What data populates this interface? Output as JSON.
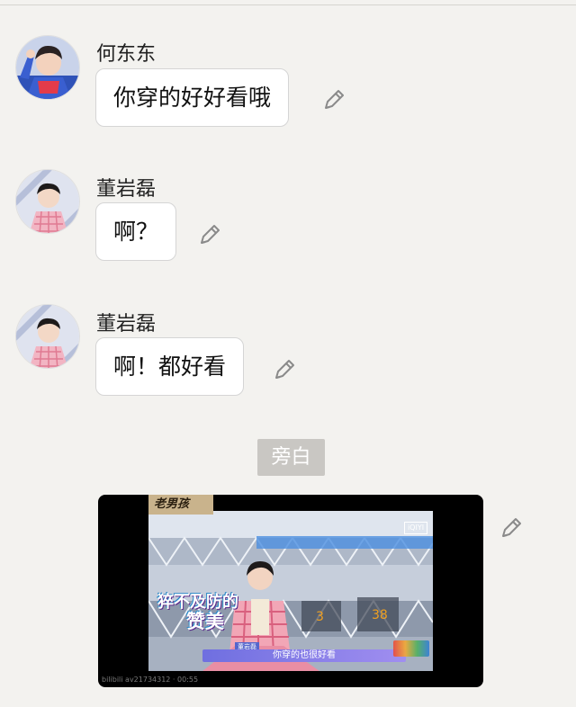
{
  "messages": [
    {
      "sender": "何东东",
      "text": "你穿的好好看哦"
    },
    {
      "sender": "董岩磊",
      "text": "啊？"
    },
    {
      "sender": "董岩磊",
      "text": "啊！都好看"
    }
  ],
  "narration_label": "旁白",
  "video": {
    "show_logo": "老男孩",
    "caption_line1": "猝不及防的",
    "caption_line2": "赞美",
    "subtitle": "你穿的也很好看",
    "person_tag": "董岩磊",
    "platform_badge": "iQIYI",
    "watermark": "bilibili av21734312 · 00:55"
  },
  "colors": {
    "background": "#f3f2ef",
    "bubble": "#ffffff",
    "narration_bg": "#c9c7c3"
  }
}
